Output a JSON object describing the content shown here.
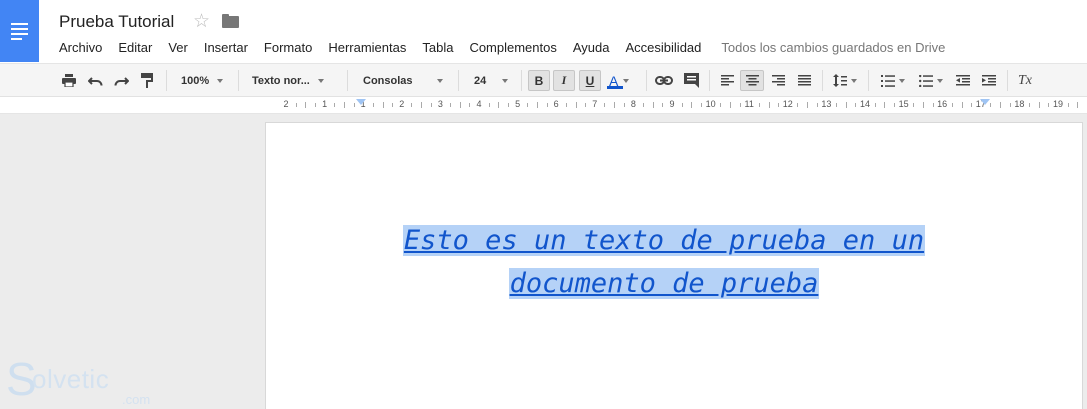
{
  "app": {
    "title": "Prueba Tutorial",
    "brand_color": "#4285f4"
  },
  "menubar": {
    "items": [
      "Archivo",
      "Editar",
      "Ver",
      "Insertar",
      "Formato",
      "Herramientas",
      "Tabla",
      "Complementos",
      "Ayuda",
      "Accesibilidad"
    ],
    "save_status": "Todos los cambios guardados en Drive"
  },
  "toolbar": {
    "zoom": "100%",
    "style": "Texto nor...",
    "font": "Consolas",
    "font_size": "24",
    "bold": "B",
    "italic": "I",
    "underline": "U",
    "text_color_glyph": "A",
    "text_color": "#1155cc",
    "clear_format_glyph": "Tx"
  },
  "ruler": {
    "labels": [
      "2",
      "1",
      "1",
      "2",
      "3",
      "4",
      "5",
      "6",
      "7",
      "8",
      "9",
      "10",
      "11",
      "12",
      "13",
      "14",
      "15",
      "16",
      "17",
      "18",
      "19"
    ]
  },
  "document": {
    "lines": [
      "Esto es un texto de prueba en un",
      "documento de prueba"
    ],
    "font_color": "#1155cc",
    "selection_color": "#b5d2f7"
  },
  "watermark": {
    "brand_s": "S",
    "brand": "olvetic",
    "suffix": ".com"
  }
}
